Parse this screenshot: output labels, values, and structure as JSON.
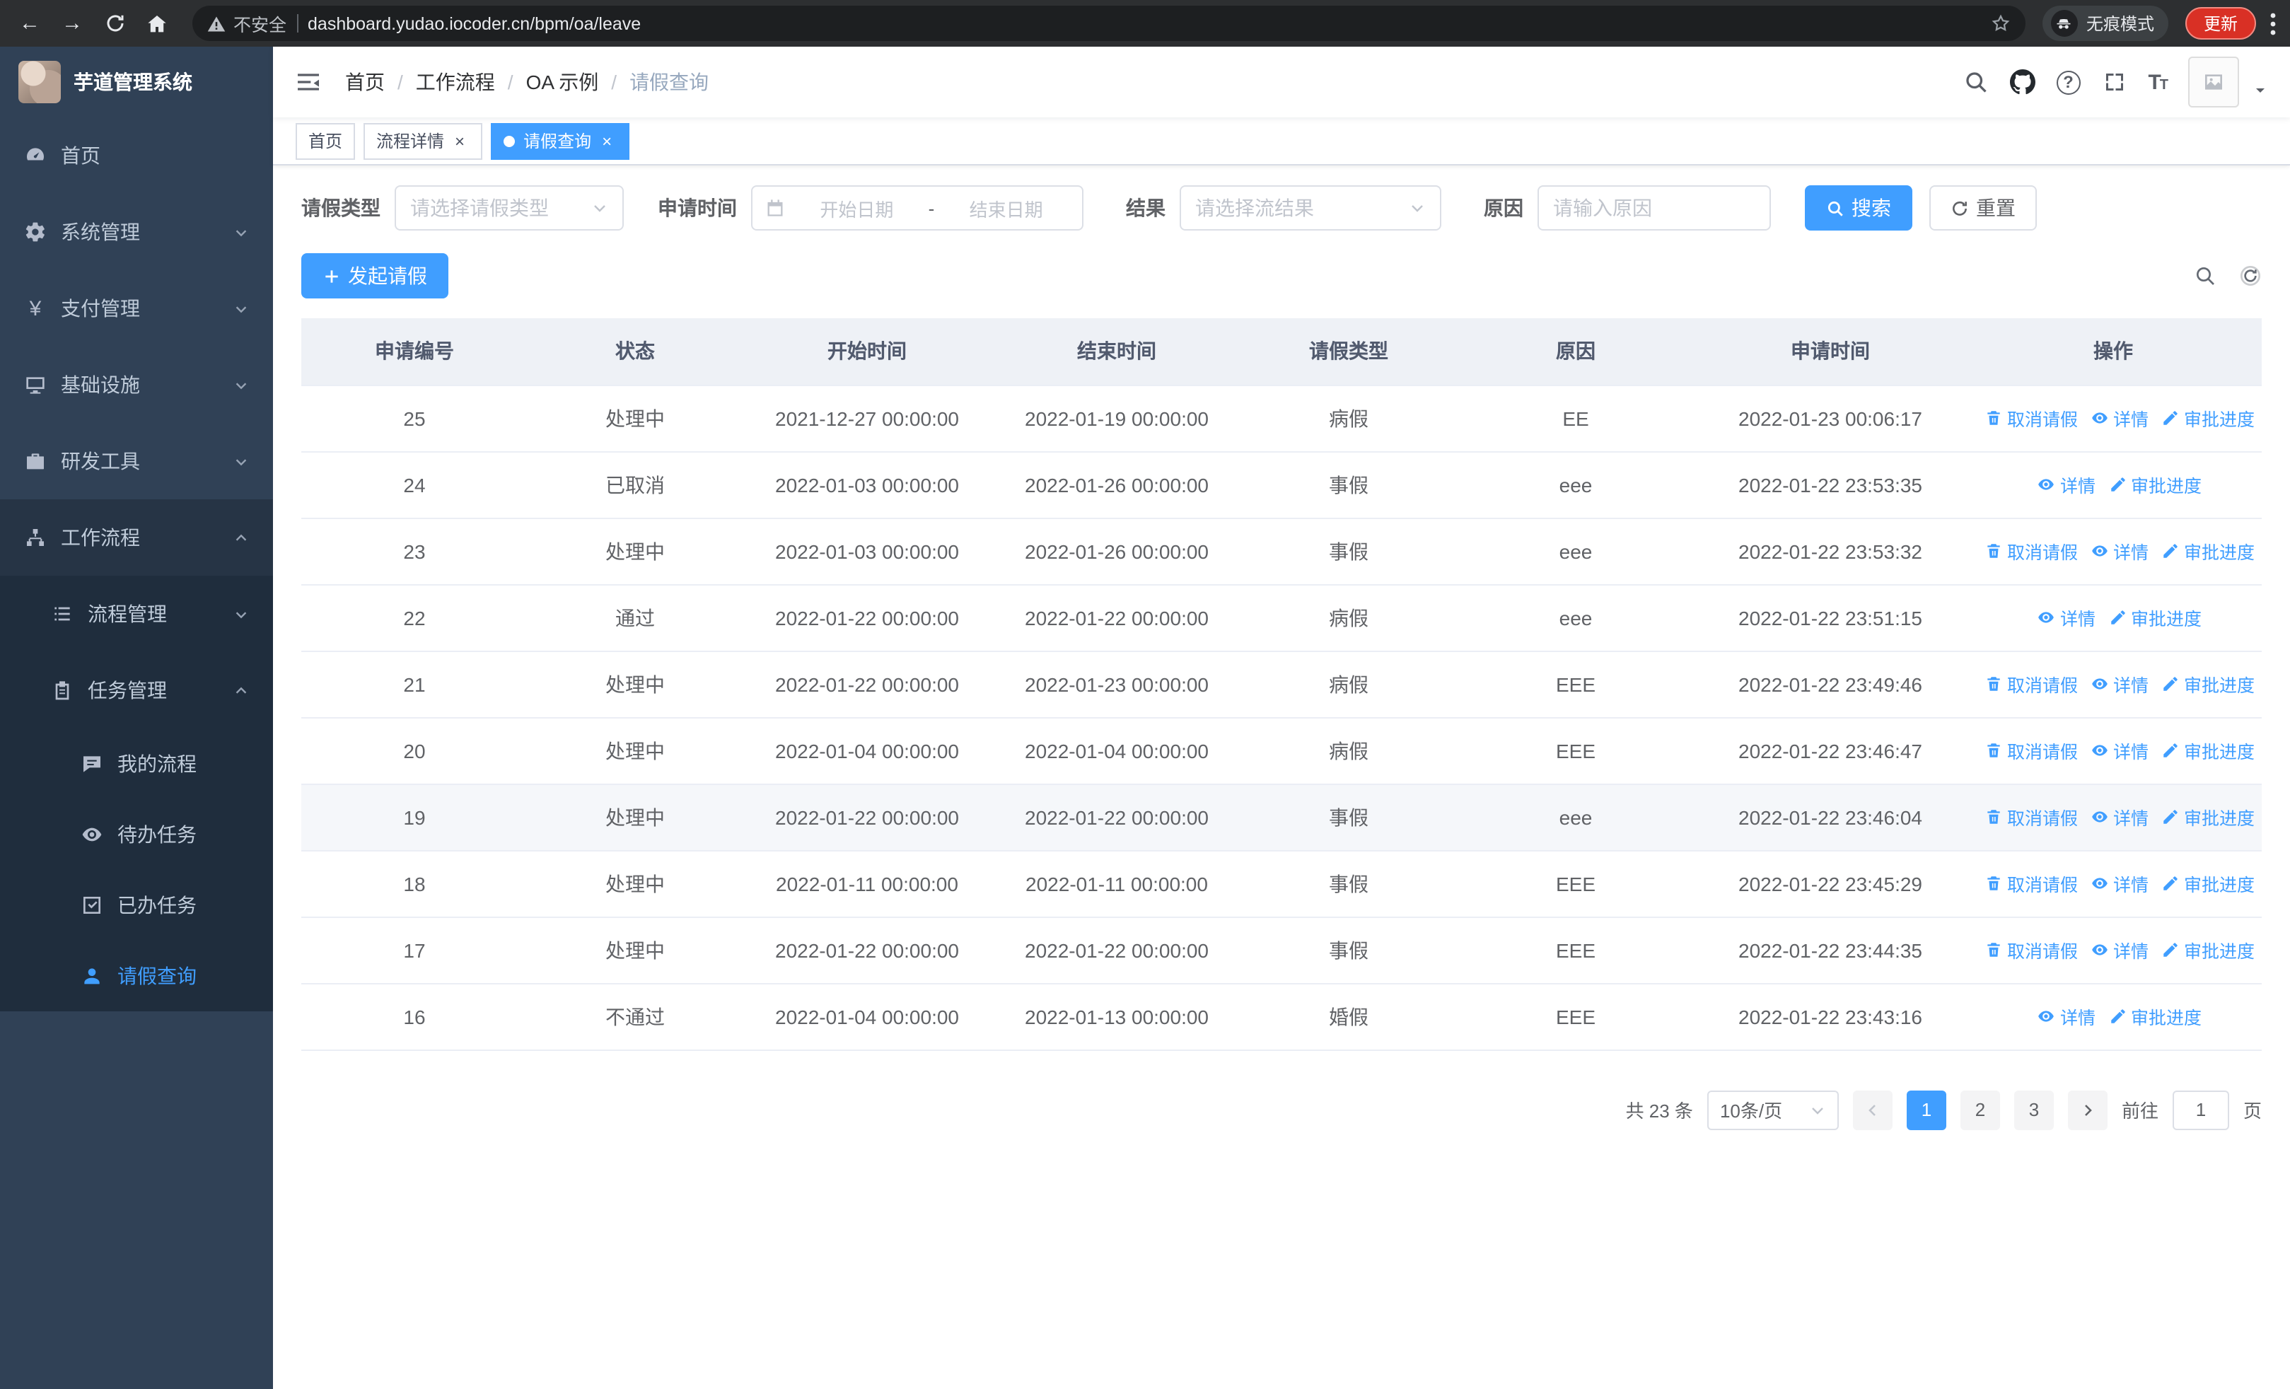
{
  "browser": {
    "security_label": "不安全",
    "url": "dashboard.yudao.iocoder.cn/bpm/oa/leave",
    "incognito_label": "无痕模式",
    "update_label": "更新"
  },
  "sidebar": {
    "app_title": "芋道管理系统",
    "items": [
      {
        "label": "首页"
      },
      {
        "label": "系统管理"
      },
      {
        "label": "支付管理"
      },
      {
        "label": "基础设施"
      },
      {
        "label": "研发工具"
      },
      {
        "label": "工作流程",
        "children": [
          {
            "label": "流程管理"
          },
          {
            "label": "任务管理",
            "children": [
              {
                "label": "我的流程"
              },
              {
                "label": "待办任务"
              },
              {
                "label": "已办任务"
              },
              {
                "label": "请假查询",
                "active": true
              }
            ]
          }
        ]
      }
    ]
  },
  "header": {
    "breadcrumb": [
      "首页",
      "工作流程",
      "OA 示例",
      "请假查询"
    ],
    "separator": "/"
  },
  "tabs": [
    {
      "label": "首页",
      "closable": false,
      "active": false
    },
    {
      "label": "流程详情",
      "closable": true,
      "active": false
    },
    {
      "label": "请假查询",
      "closable": true,
      "active": true
    }
  ],
  "ui": {
    "close_glyph": "×"
  },
  "filters": {
    "leave_type_label": "请假类型",
    "leave_type_placeholder": "请选择请假类型",
    "apply_time_label": "申请时间",
    "start_date_placeholder": "开始日期",
    "range_separator": "-",
    "end_date_placeholder": "结束日期",
    "result_label": "结果",
    "result_placeholder": "请选择流结果",
    "reason_label": "原因",
    "reason_placeholder": "请输入原因",
    "search_label": "搜索",
    "reset_label": "重置"
  },
  "toolbar": {
    "create_label": "发起请假"
  },
  "table": {
    "columns": [
      "申请编号",
      "状态",
      "开始时间",
      "结束时间",
      "请假类型",
      "原因",
      "申请时间",
      "操作"
    ],
    "action_labels": {
      "cancel": "取消请假",
      "detail": "详情",
      "progress": "审批进度"
    },
    "rows": [
      {
        "id": "25",
        "status": "处理中",
        "start": "2021-12-27 00:00:00",
        "end": "2022-01-19 00:00:00",
        "type": "病假",
        "reason": "EE",
        "apply_time": "2022-01-23 00:06:17",
        "actions": [
          "cancel",
          "detail",
          "progress"
        ]
      },
      {
        "id": "24",
        "status": "已取消",
        "start": "2022-01-03 00:00:00",
        "end": "2022-01-26 00:00:00",
        "type": "事假",
        "reason": "eee",
        "apply_time": "2022-01-22 23:53:35",
        "actions": [
          "detail",
          "progress"
        ]
      },
      {
        "id": "23",
        "status": "处理中",
        "start": "2022-01-03 00:00:00",
        "end": "2022-01-26 00:00:00",
        "type": "事假",
        "reason": "eee",
        "apply_time": "2022-01-22 23:53:32",
        "actions": [
          "cancel",
          "detail",
          "progress"
        ]
      },
      {
        "id": "22",
        "status": "通过",
        "start": "2022-01-22 00:00:00",
        "end": "2022-01-22 00:00:00",
        "type": "病假",
        "reason": "eee",
        "apply_time": "2022-01-22 23:51:15",
        "actions": [
          "detail",
          "progress"
        ]
      },
      {
        "id": "21",
        "status": "处理中",
        "start": "2022-01-22 00:00:00",
        "end": "2022-01-23 00:00:00",
        "type": "病假",
        "reason": "EEE",
        "apply_time": "2022-01-22 23:49:46",
        "actions": [
          "cancel",
          "detail",
          "progress"
        ]
      },
      {
        "id": "20",
        "status": "处理中",
        "start": "2022-01-04 00:00:00",
        "end": "2022-01-04 00:00:00",
        "type": "病假",
        "reason": "EEE",
        "apply_time": "2022-01-22 23:46:47",
        "actions": [
          "cancel",
          "detail",
          "progress"
        ]
      },
      {
        "id": "19",
        "status": "处理中",
        "start": "2022-01-22 00:00:00",
        "end": "2022-01-22 00:00:00",
        "type": "事假",
        "reason": "eee",
        "apply_time": "2022-01-22 23:46:04",
        "actions": [
          "cancel",
          "detail",
          "progress"
        ],
        "highlighted": true
      },
      {
        "id": "18",
        "status": "处理中",
        "start": "2022-01-11 00:00:00",
        "end": "2022-01-11 00:00:00",
        "type": "事假",
        "reason": "EEE",
        "apply_time": "2022-01-22 23:45:29",
        "actions": [
          "cancel",
          "detail",
          "progress"
        ]
      },
      {
        "id": "17",
        "status": "处理中",
        "start": "2022-01-22 00:00:00",
        "end": "2022-01-22 00:00:00",
        "type": "事假",
        "reason": "EEE",
        "apply_time": "2022-01-22 23:44:35",
        "actions": [
          "cancel",
          "detail",
          "progress"
        ]
      },
      {
        "id": "16",
        "status": "不通过",
        "start": "2022-01-04 00:00:00",
        "end": "2022-01-13 00:00:00",
        "type": "婚假",
        "reason": "EEE",
        "apply_time": "2022-01-22 23:43:16",
        "actions": [
          "detail",
          "progress"
        ]
      }
    ]
  },
  "pagination": {
    "total_text": "共 23 条",
    "page_size": "10条/页",
    "pages": [
      "1",
      "2",
      "3"
    ],
    "active_page": "1",
    "goto_label": "前往",
    "goto_value": "1",
    "page_unit": "页"
  },
  "colors": {
    "primary": "#409eff",
    "sidebar_bg": "#304156",
    "submenu_bg": "#1f2d3d"
  }
}
